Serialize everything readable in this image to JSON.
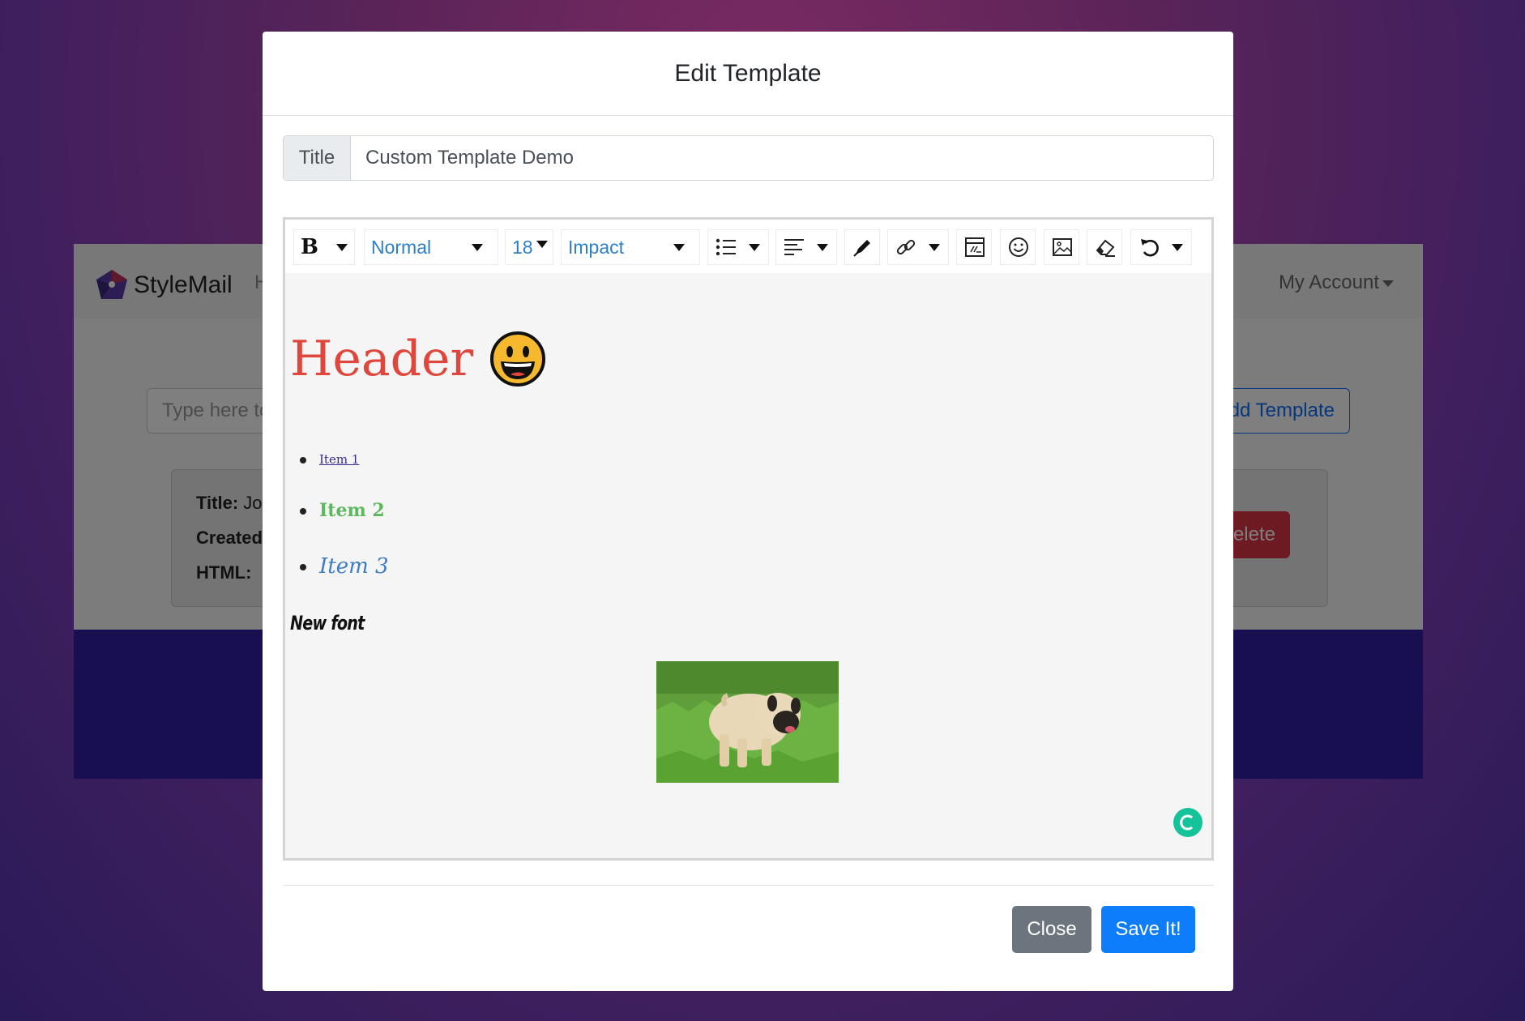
{
  "app": {
    "brand": "StyleMail",
    "nav_home": "H",
    "my_account": "My Account",
    "search_placeholder": "Type here to",
    "add_template": "dd Template",
    "card": {
      "title_label": "Title:",
      "title_value": "Jo",
      "created_label": "Created",
      "html_label": "HTML:"
    },
    "delete_label": "elete"
  },
  "modal": {
    "title": "Edit Template",
    "title_label": "Title",
    "title_value": "Custom Template Demo",
    "toolbar": {
      "bold": "B",
      "style": "Normal",
      "font_size": "18",
      "font_name": "Impact"
    },
    "content": {
      "header": "Header",
      "emoji": "😀",
      "items": [
        "Item 1",
        "Item 2",
        "Item 3"
      ],
      "new_font": "New font"
    },
    "close_label": "Close",
    "save_label": "Save It!"
  },
  "colors": {
    "header_text": "#e0473c",
    "item1": "#3a2a8a",
    "item2": "#5cb85c",
    "item3": "#3d7cc4",
    "toolbar_text": "#2d7ec8",
    "close_button": "#6c757d",
    "save_button": "#0d7dfc",
    "grammarly": "#15c39a"
  },
  "icons": [
    "bold-icon",
    "list-icon",
    "align-icon",
    "pen-icon",
    "link-icon",
    "table-icon",
    "emoji-icon",
    "image-icon",
    "eraser-icon",
    "undo-icon"
  ]
}
